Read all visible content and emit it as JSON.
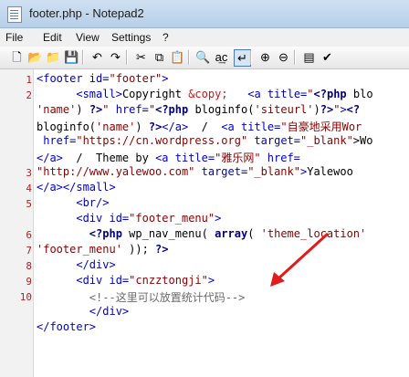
{
  "window": {
    "title": "footer.php - Notepad2"
  },
  "menu": [
    "File",
    "Edit",
    "View",
    "Settings",
    "?"
  ],
  "toolbar": [
    {
      "name": "new-file-icon",
      "glyph": "🗋"
    },
    {
      "name": "open-folder-icon",
      "glyph": "📂"
    },
    {
      "name": "browse-icon",
      "glyph": "📁"
    },
    {
      "name": "save-icon",
      "glyph": "💾"
    },
    {
      "name": "undo-icon",
      "glyph": "↶"
    },
    {
      "name": "redo-icon",
      "glyph": "↷"
    },
    {
      "name": "cut-icon",
      "glyph": "✂"
    },
    {
      "name": "copy-icon",
      "glyph": "⧉"
    },
    {
      "name": "paste-icon",
      "glyph": "📋"
    },
    {
      "name": "find-icon",
      "glyph": "🔍"
    },
    {
      "name": "replace-icon",
      "glyph": "a͢c"
    },
    {
      "name": "word-wrap-icon",
      "glyph": "↵"
    },
    {
      "name": "zoom-in-icon",
      "glyph": "⊕"
    },
    {
      "name": "zoom-out-icon",
      "glyph": "⊖"
    },
    {
      "name": "schemes-icon",
      "glyph": "▤"
    },
    {
      "name": "customize-icon",
      "glyph": "✔"
    }
  ],
  "line_numbers": [
    "1",
    "2",
    "",
    "",
    "",
    "",
    "3",
    "4",
    "5",
    "",
    "6",
    "7",
    "8",
    "9",
    "10"
  ],
  "code_lines": [
    [
      [
        "t",
        "<footer "
      ],
      [
        "a",
        "id="
      ],
      [
        "s",
        "\"footer\""
      ],
      [
        "t",
        ">"
      ]
    ],
    [
      [
        "tx",
        "      "
      ],
      [
        "t",
        "<small>"
      ],
      [
        "tx",
        "Copyright "
      ],
      [
        "ent",
        "&copy;"
      ],
      [
        "tx",
        "   "
      ],
      [
        "t",
        "<a "
      ],
      [
        "a",
        "title="
      ],
      [
        "s",
        "\""
      ],
      [
        "k",
        "<?php "
      ],
      [
        "f",
        "blo"
      ]
    ],
    [
      [
        "s",
        "'name'"
      ],
      [
        "f",
        ") "
      ],
      [
        "k",
        "?>"
      ],
      [
        "s",
        "\""
      ],
      [
        "a",
        " href="
      ],
      [
        "s",
        "\""
      ],
      [
        "k",
        "<?php "
      ],
      [
        "f",
        "bloginfo("
      ],
      [
        "s",
        "'siteurl'"
      ],
      [
        "f",
        ")"
      ],
      [
        "k",
        "?>"
      ],
      [
        "s",
        "\""
      ],
      [
        "t",
        ">"
      ],
      [
        "k",
        "<?"
      ]
    ],
    [
      [
        "f",
        "bloginfo("
      ],
      [
        "s",
        "'name'"
      ],
      [
        "f",
        ") "
      ],
      [
        "k",
        "?>"
      ],
      [
        "t",
        "</a>"
      ],
      [
        "tx",
        "  /  "
      ],
      [
        "t",
        "<a "
      ],
      [
        "a",
        "title="
      ],
      [
        "s",
        "\"自豪地采用Wor"
      ]
    ],
    [
      [
        "a",
        " href="
      ],
      [
        "s",
        "\"https://cn.wordpress.org\""
      ],
      [
        "a",
        " target="
      ],
      [
        "s",
        "\"_blank\""
      ],
      [
        "tx",
        ">Wo"
      ]
    ],
    [
      [
        "t",
        "</a>"
      ],
      [
        "tx",
        "  /  Theme by "
      ],
      [
        "t",
        "<a "
      ],
      [
        "a",
        "title="
      ],
      [
        "s",
        "\"雅乐网\""
      ],
      [
        "a",
        " href="
      ]
    ],
    [
      [
        "s",
        "\"http://www.yalewoo.com\""
      ],
      [
        "a",
        " target="
      ],
      [
        "s",
        "\"_blank\""
      ],
      [
        "t",
        ">"
      ],
      [
        "tx",
        "Yalewoo"
      ]
    ],
    [
      [
        "t",
        "</a></small>"
      ]
    ],
    [
      [
        "tx",
        "      "
      ],
      [
        "t",
        "<br/>"
      ]
    ],
    [
      [
        "tx",
        "      "
      ],
      [
        "t",
        "<div "
      ],
      [
        "a",
        "id="
      ],
      [
        "s",
        "\"footer_menu\""
      ],
      [
        "t",
        ">"
      ]
    ],
    [
      [
        "tx",
        "        "
      ],
      [
        "k",
        "<?php "
      ],
      [
        "f",
        "wp_nav_menu( "
      ],
      [
        "k",
        "array"
      ],
      [
        "f",
        "( "
      ],
      [
        "s",
        "'theme_location'"
      ]
    ],
    [
      [
        "s",
        "'footer_menu'"
      ],
      [
        "f",
        " )); "
      ],
      [
        "k",
        "?>"
      ]
    ],
    [
      [
        "tx",
        "      "
      ],
      [
        "t",
        "</div>"
      ]
    ],
    [
      [
        "tx",
        "      "
      ],
      [
        "t",
        "<div "
      ],
      [
        "a",
        "id="
      ],
      [
        "s",
        "\"cnzztongji\""
      ],
      [
        "t",
        ">"
      ]
    ],
    [
      [
        "tx",
        "        "
      ],
      [
        "cm",
        "<!--这里可以放置统计代码-->"
      ]
    ],
    [
      [
        "tx",
        "        "
      ],
      [
        "t",
        "</div>"
      ]
    ],
    [
      [
        "t",
        "</footer>"
      ]
    ]
  ]
}
